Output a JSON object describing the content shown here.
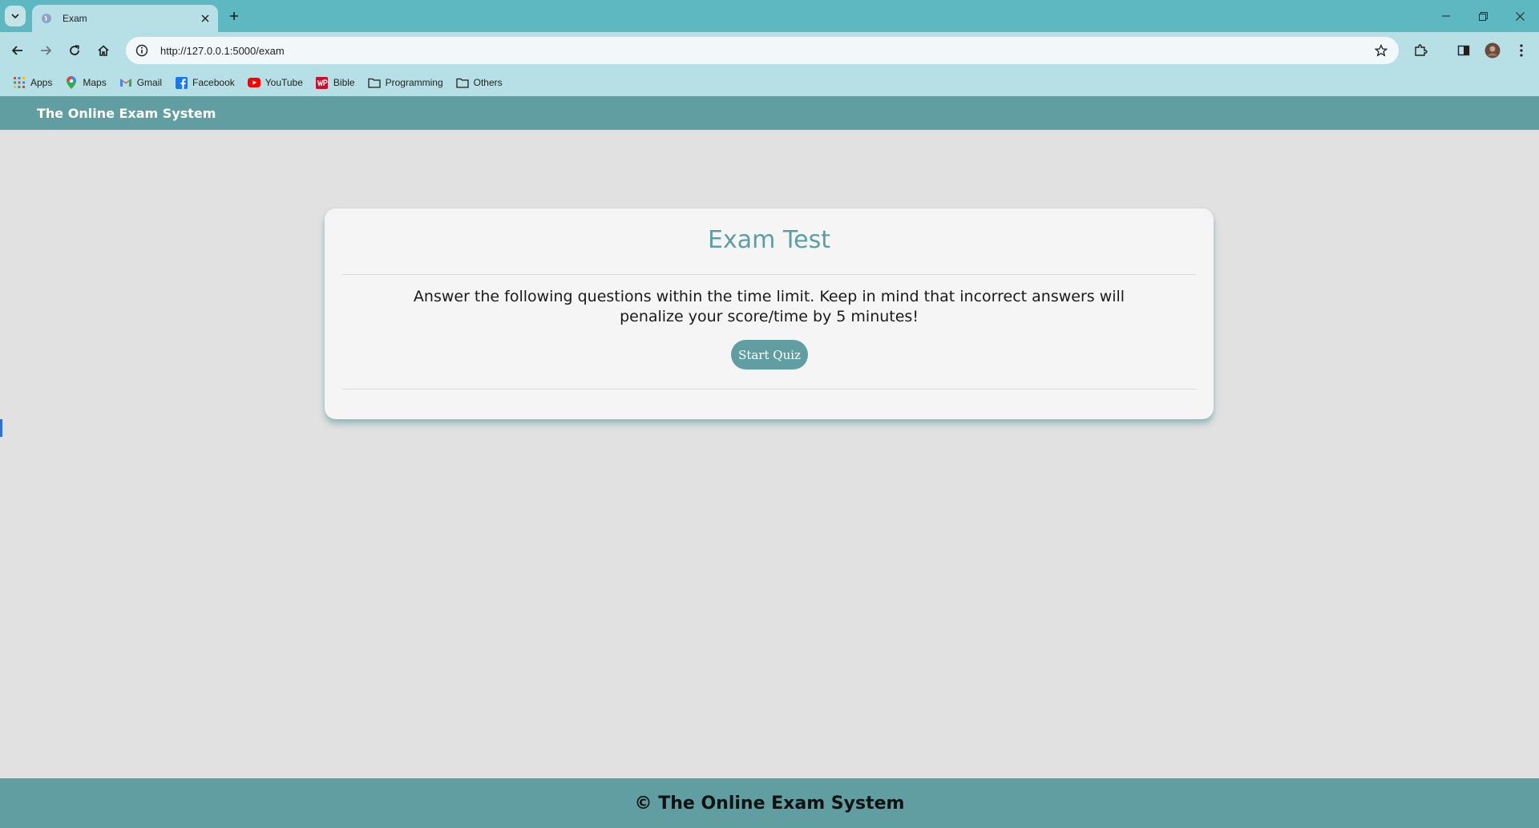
{
  "browser": {
    "tab": {
      "title": "Exam",
      "favicon": "app-favicon"
    },
    "url": "http://127.0.0.1:5000/exam",
    "bookmarks": [
      {
        "label": "Apps",
        "icon": "apps-grid-icon"
      },
      {
        "label": "Maps",
        "icon": "maps-pin-icon"
      },
      {
        "label": "Gmail",
        "icon": "gmail-icon"
      },
      {
        "label": "Facebook",
        "icon": "facebook-icon"
      },
      {
        "label": "YouTube",
        "icon": "youtube-icon"
      },
      {
        "label": "Bible",
        "icon": "bible-icon"
      },
      {
        "label": "Programming",
        "icon": "folder-icon"
      },
      {
        "label": "Others",
        "icon": "folder-icon"
      }
    ]
  },
  "header": {
    "brand": "The Online Exam System"
  },
  "card": {
    "title": "Exam Test",
    "instructions": "Answer the following questions within the time limit. Keep in mind that incorrect answers will penalize your score/time by 5 minutes!",
    "start_button": "Start Quiz"
  },
  "footer": {
    "text": "© The Online Exam System"
  },
  "colors": {
    "tab_strip": "#5db8c1",
    "toolbar": "#b6e0e5",
    "accent": "#609ea1",
    "title": "#5c9ea2",
    "page_bg": "#e1e1e1"
  }
}
